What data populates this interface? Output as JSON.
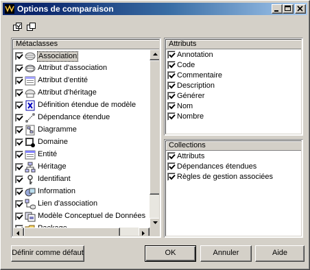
{
  "window": {
    "title": "Options de comparaison"
  },
  "toolbar": {
    "icons": [
      "select-all-icon",
      "deselect-all-icon"
    ]
  },
  "metaclasses": {
    "header": "Métaclasses",
    "items": [
      {
        "label": "Association",
        "checked": true,
        "icon": "association-icon",
        "selected": true
      },
      {
        "label": "Attribut d'association",
        "checked": true,
        "icon": "association-attribute-icon"
      },
      {
        "label": "Attribut d'entité",
        "checked": true,
        "icon": "entity-attribute-icon"
      },
      {
        "label": "Attribut d'héritage",
        "checked": true,
        "icon": "inheritance-attribute-icon"
      },
      {
        "label": "Définition étendue de modèle",
        "checked": true,
        "icon": "extended-model-definition-icon"
      },
      {
        "label": "Dépendance étendue",
        "checked": true,
        "icon": "extended-dependency-icon"
      },
      {
        "label": "Diagramme",
        "checked": true,
        "icon": "diagram-icon"
      },
      {
        "label": "Domaine",
        "checked": true,
        "icon": "domain-icon"
      },
      {
        "label": "Entité",
        "checked": true,
        "icon": "entity-icon"
      },
      {
        "label": "Héritage",
        "checked": true,
        "icon": "inheritance-icon"
      },
      {
        "label": "Identifiant",
        "checked": true,
        "icon": "identifier-icon"
      },
      {
        "label": "Information",
        "checked": true,
        "icon": "information-icon"
      },
      {
        "label": "Lien d'association",
        "checked": true,
        "icon": "association-link-icon"
      },
      {
        "label": "Modèle Conceptuel de Données",
        "checked": true,
        "icon": "conceptual-data-model-icon"
      },
      {
        "label": "Package",
        "checked": true,
        "icon": "package-icon"
      }
    ]
  },
  "attributs": {
    "header": "Attributs",
    "items": [
      {
        "label": "Annotation",
        "checked": true
      },
      {
        "label": "Code",
        "checked": true
      },
      {
        "label": "Commentaire",
        "checked": true
      },
      {
        "label": "Description",
        "checked": true
      },
      {
        "label": "Générer",
        "checked": true
      },
      {
        "label": "Nom",
        "checked": true
      },
      {
        "label": "Nombre",
        "checked": true
      }
    ]
  },
  "collections": {
    "header": "Collections",
    "items": [
      {
        "label": "Attributs",
        "checked": true
      },
      {
        "label": "Dépendances étendues",
        "checked": true
      },
      {
        "label": "Règles de gestion associées",
        "checked": true
      }
    ]
  },
  "buttons": {
    "set_default": "Définir comme défaut",
    "ok": "OK",
    "cancel": "Annuler",
    "help": "Aide"
  }
}
